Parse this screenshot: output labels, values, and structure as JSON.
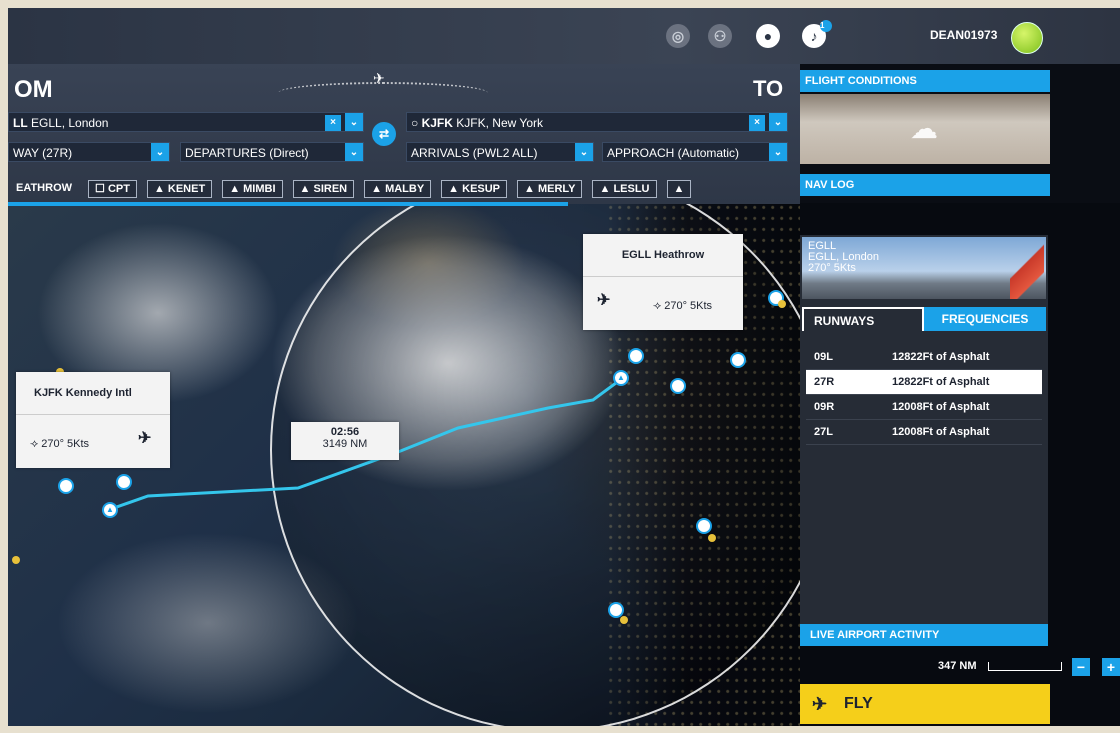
{
  "header": {
    "username": "DEAN01973",
    "notification_count": "1",
    "icons": [
      "activity-icon",
      "friends-icon",
      "profile-icon",
      "notifications-icon"
    ]
  },
  "route": {
    "from_heading": "OM",
    "to_heading": "TO",
    "from_airport_code": "LL",
    "from_airport_name": "EGLL, London",
    "to_airport_code": "KJFK",
    "to_airport_name": "KJFK, New York",
    "runway": "WAY (27R)",
    "departures": "DEPARTURES (Direct)",
    "arrivals": "ARRIVALS (PWL2 ALL)",
    "approach": "APPROACH (Automatic)",
    "waypoints": [
      {
        "icon": "",
        "label": "EATHROW"
      },
      {
        "icon": "☐",
        "label": "CPT"
      },
      {
        "icon": "▲",
        "label": "KENET"
      },
      {
        "icon": "▲",
        "label": "MIMBI"
      },
      {
        "icon": "▲",
        "label": "SIREN"
      },
      {
        "icon": "▲",
        "label": "MALBY"
      },
      {
        "icon": "▲",
        "label": "KESUP"
      },
      {
        "icon": "▲",
        "label": "MERLY"
      },
      {
        "icon": "▲",
        "label": "LESLU"
      },
      {
        "icon": "▲",
        "label": ""
      }
    ]
  },
  "right_panel": {
    "flight_conditions": "FLIGHT CONDITIONS",
    "nav_log": "NAV LOG",
    "airport_photo_lines": [
      "EGLL",
      "EGLL, London",
      "270° 5Kts"
    ],
    "tab_runways": "RUNWAYS",
    "tab_frequencies": "FREQUENCIES",
    "runways": [
      {
        "id": "09L",
        "desc": "12822Ft of Asphalt",
        "selected": false
      },
      {
        "id": "27R",
        "desc": "12822Ft of Asphalt",
        "selected": true
      },
      {
        "id": "09R",
        "desc": "12008Ft of Asphalt",
        "selected": false
      },
      {
        "id": "27L",
        "desc": "12008Ft of Asphalt",
        "selected": false
      }
    ],
    "live_activity": "LIVE AIRPORT ACTIVITY"
  },
  "map": {
    "departure_box": {
      "name": "EGLL Heathrow",
      "wind": "270° 5Kts"
    },
    "arrival_box": {
      "name": "KJFK Kennedy Intl",
      "wind": "270° 5Kts"
    },
    "eta_time": "02:56",
    "eta_distance": "3149 NM",
    "scale": "347 NM"
  },
  "controls": {
    "zoom_out": "−",
    "zoom_in": "+",
    "fly": "FLY"
  },
  "colors": {
    "accent": "#1ba2e8",
    "fly_button": "#f5cf1a",
    "route_line": "#34c6ec"
  }
}
